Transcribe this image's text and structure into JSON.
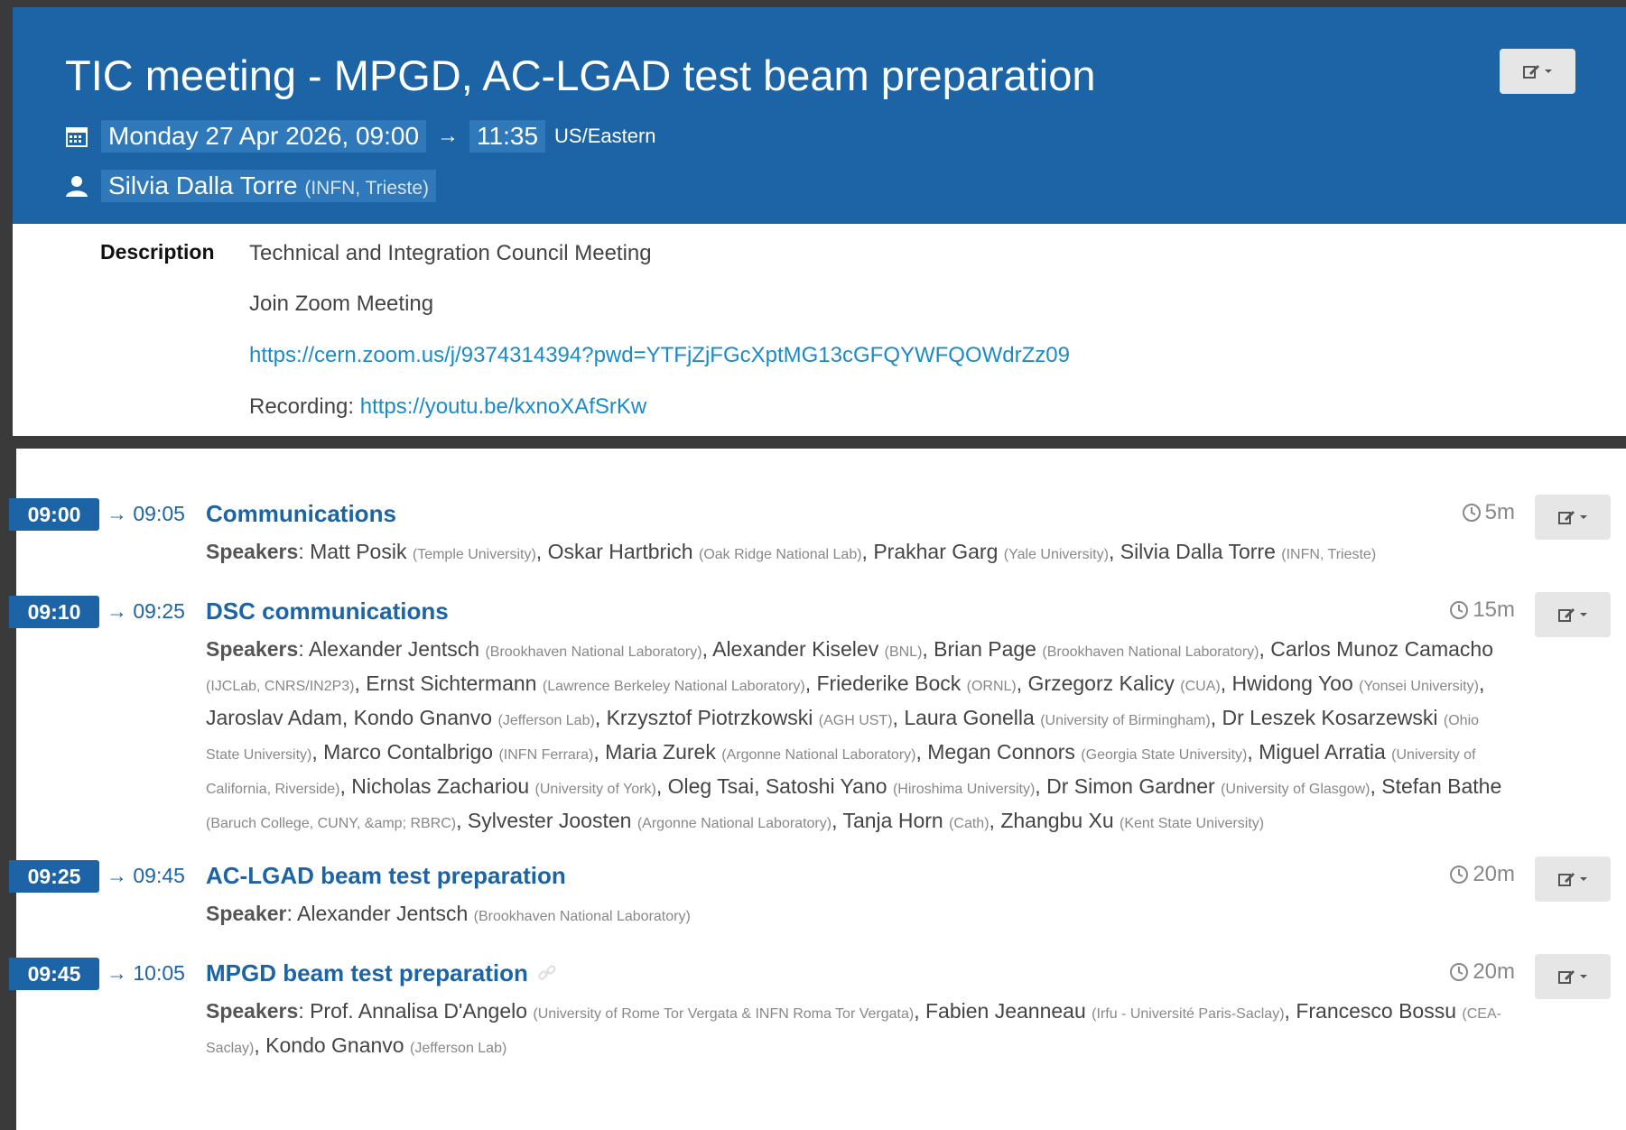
{
  "event": {
    "title": "TIC meeting - MPGD, AC-LGAD test beam preparation",
    "date_start": "Monday 27 Apr 2026, 09:00",
    "arrow": "→",
    "time_end": "11:35",
    "timezone": "US/Eastern",
    "chair_name": "Silvia Dalla Torre",
    "chair_aff": "(INFN, Trieste)"
  },
  "description": {
    "label": "Description",
    "line1": "Technical and Integration Council Meeting",
    "line2": "Join Zoom Meeting",
    "zoom_link": "https://cern.zoom.us/j/9374314394?pwd=YTFjZjFGcXptMG13cGFQYWFQOWdrZz09",
    "recording_label": "Recording: ",
    "recording_link": "https://youtu.be/kxnoXAfSrKw"
  },
  "colors": {
    "header_bg": "#1c64a5",
    "link": "#1a8bc7",
    "time_badge": "#1c64a5"
  },
  "timetable": [
    {
      "start": "09:00",
      "end": "→ 09:05",
      "title": "Communications",
      "duration": "5m",
      "speakers_label": "Speakers",
      "speakers": [
        {
          "name": "Matt Posik",
          "aff": "(Temple University)"
        },
        {
          "name": "Oskar Hartbrich",
          "aff": "(Oak Ridge National Lab)"
        },
        {
          "name": "Prakhar Garg",
          "aff": "(Yale University)"
        },
        {
          "name": "Silvia Dalla Torre",
          "aff": "(INFN, Trieste)"
        }
      ]
    },
    {
      "start": "09:10",
      "end": "→ 09:25",
      "title": "DSC communications",
      "duration": "15m",
      "speakers_label": "Speakers",
      "speakers": [
        {
          "name": "Alexander Jentsch",
          "aff": "(Brookhaven National Laboratory)"
        },
        {
          "name": "Alexander Kiselev",
          "aff": "(BNL)"
        },
        {
          "name": "Brian Page",
          "aff": "(Brookhaven National Laboratory)"
        },
        {
          "name": "Carlos Munoz Camacho",
          "aff": "(IJCLab, CNRS/IN2P3)"
        },
        {
          "name": "Ernst Sichtermann",
          "aff": "(Lawrence Berkeley National Laboratory)"
        },
        {
          "name": "Friederike Bock",
          "aff": "(ORNL)"
        },
        {
          "name": "Grzegorz Kalicy",
          "aff": "(CUA)"
        },
        {
          "name": "Hwidong Yoo",
          "aff": "(Yonsei University)"
        },
        {
          "name": "Jaroslav Adam",
          "aff": ""
        },
        {
          "name": "Kondo Gnanvo",
          "aff": "(Jefferson Lab)"
        },
        {
          "name": "Krzysztof Piotrzkowski",
          "aff": "(AGH UST)"
        },
        {
          "name": "Laura Gonella",
          "aff": "(University of Birmingham)"
        },
        {
          "name": "Dr Leszek Kosarzewski",
          "aff": "(Ohio State University)"
        },
        {
          "name": "Marco Contalbrigo",
          "aff": "(INFN Ferrara)"
        },
        {
          "name": "Maria Zurek",
          "aff": "(Argonne National Laboratory)"
        },
        {
          "name": "Megan Connors",
          "aff": "(Georgia State University)"
        },
        {
          "name": "Miguel Arratia",
          "aff": "(University of California, Riverside)"
        },
        {
          "name": "Nicholas Zachariou",
          "aff": "(University of York)"
        },
        {
          "name": "Oleg Tsai",
          "aff": ""
        },
        {
          "name": "Satoshi Yano",
          "aff": "(Hiroshima University)"
        },
        {
          "name": "Dr Simon Gardner",
          "aff": "(University of Glasgow)"
        },
        {
          "name": "Stefan Bathe",
          "aff": "(Baruch College, CUNY, &amp; RBRC)"
        },
        {
          "name": "Sylvester Joosten",
          "aff": "(Argonne National Laboratory)"
        },
        {
          "name": "Tanja Horn",
          "aff": "(Cath)"
        },
        {
          "name": "Zhangbu Xu",
          "aff": "(Kent State University)"
        }
      ]
    },
    {
      "start": "09:25",
      "end": "→ 09:45",
      "title": "AC-LGAD beam test preparation",
      "duration": "20m",
      "speakers_label": "Speaker",
      "speakers": [
        {
          "name": "Alexander Jentsch",
          "aff": "(Brookhaven National Laboratory)"
        }
      ]
    },
    {
      "start": "09:45",
      "end": "→ 10:05",
      "title": "MPGD beam test preparation",
      "duration": "20m",
      "speakers_label": "Speakers",
      "speakers": [
        {
          "name": "Prof. Annalisa D'Angelo",
          "aff": "(University of Rome Tor Vergata & INFN Roma Tor Vergata)"
        },
        {
          "name": "Fabien Jeanneau",
          "aff": "(Irfu - Université Paris-Saclay)"
        },
        {
          "name": "Francesco Bossu",
          "aff": "(CEA-Saclay)"
        },
        {
          "name": "Kondo Gnanvo",
          "aff": "(Jefferson Lab)"
        }
      ]
    }
  ]
}
